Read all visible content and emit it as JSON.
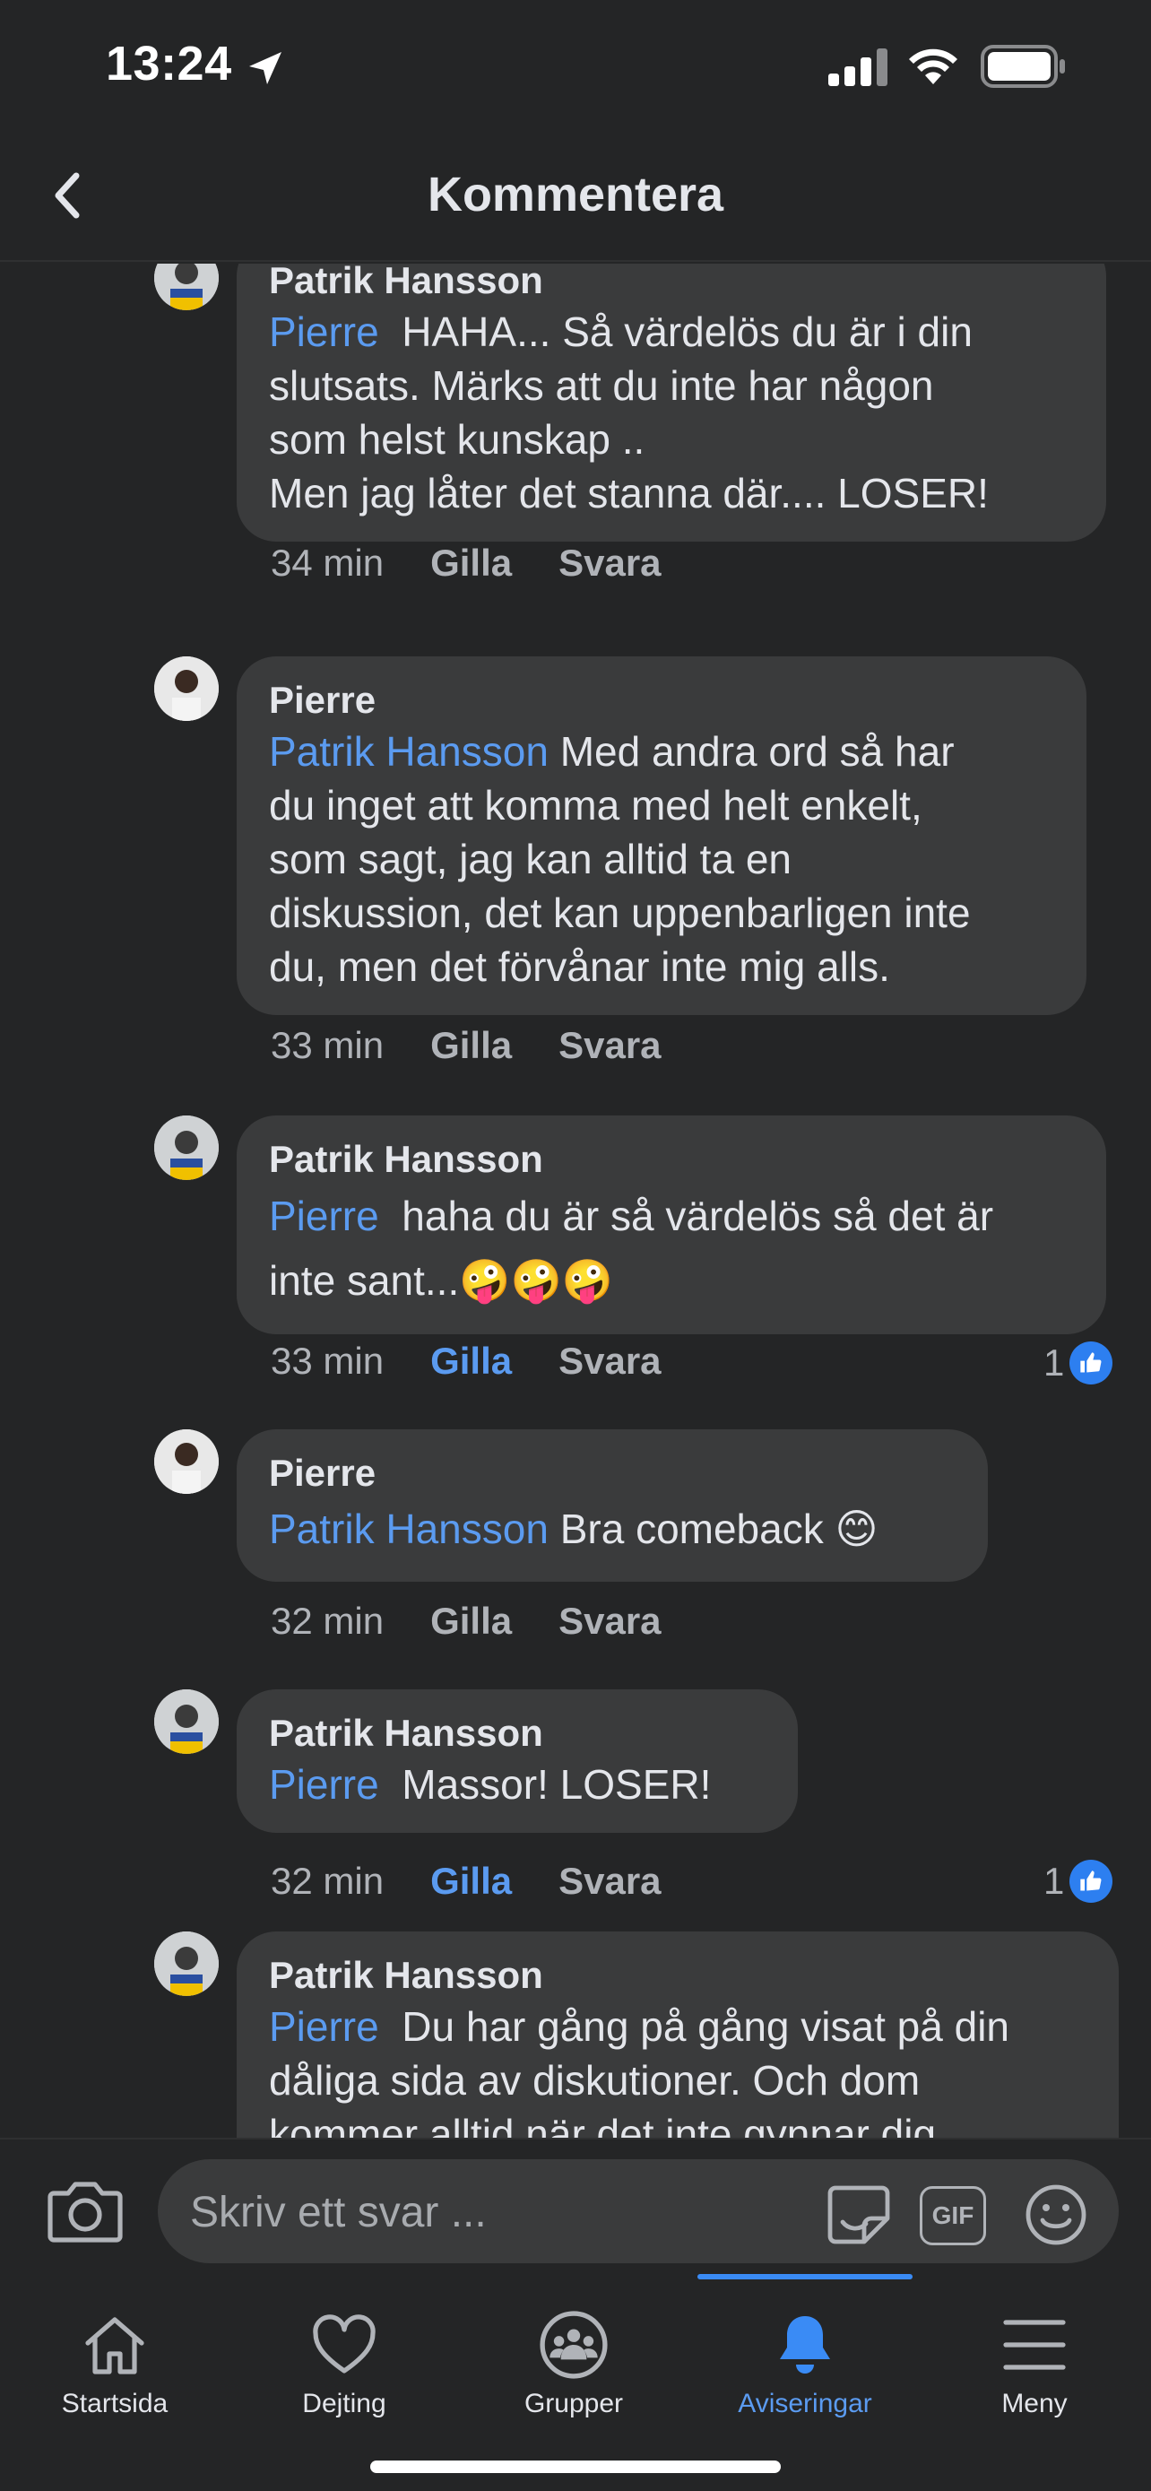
{
  "status_bar": {
    "time": "13:24"
  },
  "header": {
    "title": "Kommentera",
    "back_icon": "chevron-left-icon"
  },
  "comments": [
    {
      "author": "Patrik Hansson",
      "mention": "Pierre",
      "text_lines": [
        "HAHA... Så värdelös du är i din",
        "slutsats. Märks att du inte har någon",
        "som helst kunskap ..",
        "Men jag låter det stanna där....   LOSER!"
      ],
      "time": "34 min",
      "like": "Gilla",
      "reply": "Svara",
      "liked": false,
      "reactions": ""
    },
    {
      "author": "Pierre",
      "mention": "Patrik Hansson",
      "text_lines": [
        "Med andra ord så har",
        "du inget att komma med helt enkelt,",
        "som sagt, jag kan alltid ta en",
        "diskussion, det kan uppenbarligen inte",
        "du, men det förvånar inte mig alls."
      ],
      "time": "33 min",
      "like": "Gilla",
      "reply": "Svara",
      "liked": false,
      "reactions": ""
    },
    {
      "author": "Patrik Hansson",
      "mention": "Pierre",
      "text_lines": [
        "haha  du är så värdelös så det är",
        "inte sant...🤪🤪🤪"
      ],
      "time": "33 min",
      "like": "Gilla",
      "reply": "Svara",
      "liked": true,
      "reactions": "1"
    },
    {
      "author": "Pierre",
      "mention": "Patrik Hansson",
      "text_lines": [
        "Bra comeback 😊"
      ],
      "time": "32 min",
      "like": "Gilla",
      "reply": "Svara",
      "liked": false,
      "reactions": ""
    },
    {
      "author": "Patrik Hansson",
      "mention": "Pierre",
      "text_lines": [
        "Massor!   LOSER!"
      ],
      "time": "32 min",
      "like": "Gilla",
      "reply": "Svara",
      "liked": true,
      "reactions": "1"
    },
    {
      "author": "Patrik Hansson",
      "mention": "Pierre",
      "text_lines": [
        "Du har gång på gång visat på din",
        "dåliga sida  av diskutioner. Och dom",
        "kommer alltid när det inte gynnar dig"
      ],
      "time": "",
      "like": "",
      "reply": "",
      "liked": false,
      "reactions": ""
    }
  ],
  "composer": {
    "placeholder": "Skriv ett svar ...",
    "gif_label": "GIF"
  },
  "tabs": [
    {
      "label": "Startsida",
      "icon": "home-icon",
      "active": false
    },
    {
      "label": "Dejting",
      "icon": "heart-icon",
      "active": false
    },
    {
      "label": "Grupper",
      "icon": "groups-icon",
      "active": false
    },
    {
      "label": "Aviseringar",
      "icon": "bell-icon",
      "active": true
    },
    {
      "label": "Meny",
      "icon": "menu-icon",
      "active": false
    }
  ],
  "colors": {
    "background": "#242526",
    "bubble": "#3a3b3c",
    "accent": "#5b9bf0"
  }
}
